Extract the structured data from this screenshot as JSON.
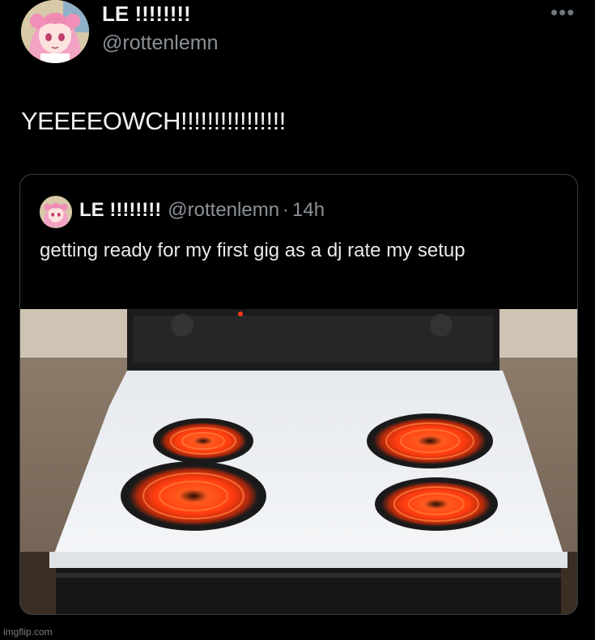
{
  "post": {
    "display_name": "LE !!!!!!!!",
    "handle": "@rottenlemn",
    "more_icon": "more-horizontal-icon",
    "text": "YEEEEOWCH!!!!!!!!!!!!!!!!"
  },
  "quoted_post": {
    "display_name": "LE !!!!!!!!",
    "handle": "@rottenlemn",
    "separator": "·",
    "time": "14h",
    "text": "getting ready for my first gig as a dj rate my setup"
  },
  "watermark": "imgflip.com"
}
